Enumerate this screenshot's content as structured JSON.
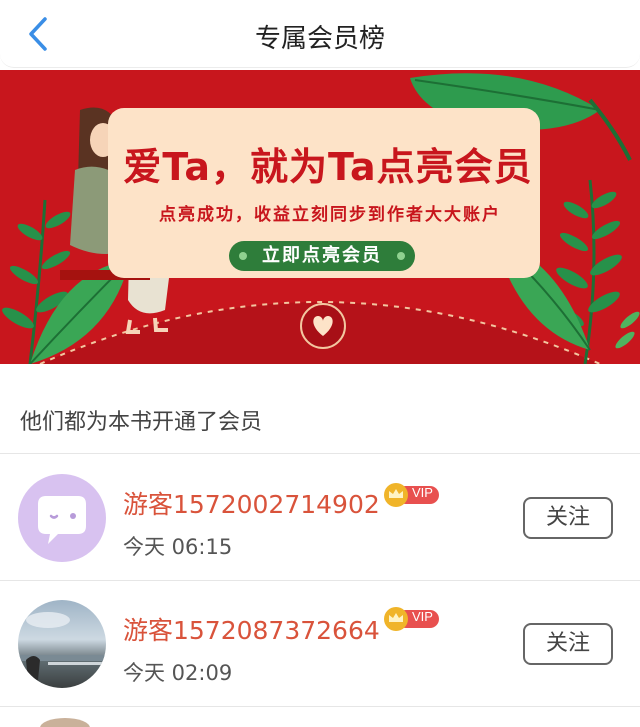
{
  "header": {
    "title": "专属会员榜",
    "accent": "#3a8ee6"
  },
  "banner": {
    "title": "爱Ta，就为Ta点亮会员",
    "subtitle": "点亮成功，收益立刻同步到作者大大账户",
    "cta_label": "立即点亮会员",
    "background": "#c8161d",
    "card_color": "#fde3c8",
    "cta_color": "#2e7d3a"
  },
  "section": {
    "label": "他们都为本书开通了会员"
  },
  "members": [
    {
      "name": "游客1572002714902",
      "badge": "VIP",
      "time": "今天 06:15",
      "follow_label": "关注",
      "avatar": "chat-bubble-avatar"
    },
    {
      "name": "游客1572087372664",
      "badge": "VIP",
      "time": "今天 02:09",
      "follow_label": "关注",
      "avatar": "photo-avatar"
    }
  ],
  "colors": {
    "name": "#d9533b",
    "vip": "#e8504f",
    "crown": "#f0b429"
  }
}
